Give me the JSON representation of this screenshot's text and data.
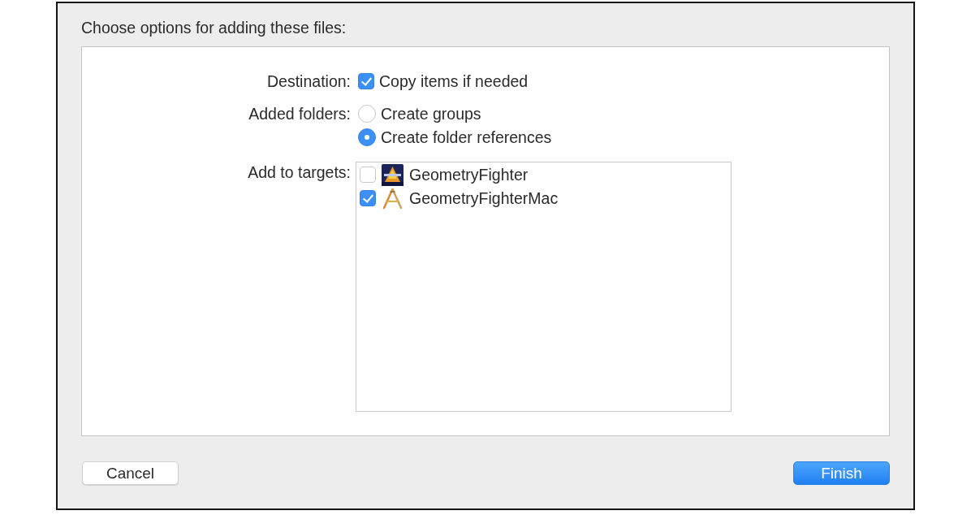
{
  "dialog": {
    "title": "Choose options for adding these files:"
  },
  "destination": {
    "label": "Destination:",
    "option": {
      "label": "Copy items if needed",
      "checked": true
    }
  },
  "added_folders": {
    "label": "Added folders:",
    "options": [
      {
        "label": "Create groups",
        "selected": false
      },
      {
        "label": "Create folder references",
        "selected": true
      }
    ]
  },
  "targets": {
    "label": "Add to targets:",
    "items": [
      {
        "name": "GeometryFighter",
        "checked": false,
        "kind": "game"
      },
      {
        "name": "GeometryFighterMac",
        "checked": true,
        "kind": "app"
      }
    ]
  },
  "buttons": [
    {
      "label": "Cancel",
      "kind": "secondary"
    },
    {
      "label": "Finish",
      "kind": "primary"
    }
  ]
}
